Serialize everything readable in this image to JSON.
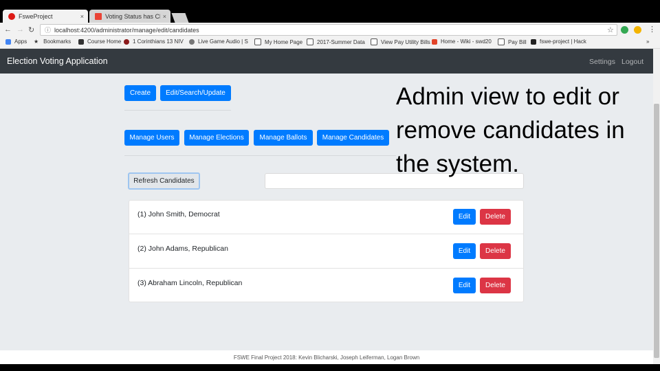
{
  "browser": {
    "tabs": [
      {
        "title": "FsweProject",
        "close": "×",
        "favicon_color": "#dd1b16"
      },
      {
        "title": "Voting Status has Change",
        "close": "×",
        "favicon_color": "#ea4335"
      }
    ],
    "url": "localhost:4200/administrator/manage/edit/candidates",
    "bookmarks": [
      {
        "label": "Apps"
      },
      {
        "label": "Bookmarks"
      },
      {
        "label": "Course Home"
      },
      {
        "label": "1 Corinthians 13 NIV"
      },
      {
        "label": "Live Game Audio | S"
      },
      {
        "label": "My Home Page"
      },
      {
        "label": "2017-Summer Data"
      },
      {
        "label": "View Pay Utility Bills"
      },
      {
        "label": "Home - Wiki - swd20"
      },
      {
        "label": "Pay Bill"
      },
      {
        "label": "fswe-project | Hack"
      },
      {
        "label": "»"
      }
    ]
  },
  "app": {
    "brand": "Election Voting Application",
    "nav": {
      "settings": "Settings",
      "logout": "Logout"
    },
    "toolbar": {
      "create": "Create",
      "edit_search_update": "Edit/Search/Update"
    },
    "manage": {
      "users": "Manage Users",
      "elections": "Manage Elections",
      "ballots": "Manage Ballots",
      "candidates": "Manage Candidates"
    },
    "refresh_label": "Refresh Candidates",
    "search_value": "",
    "candidates": [
      {
        "label": "(1) John Smith, Democrat",
        "edit": "Edit",
        "delete": "Delete"
      },
      {
        "label": "(2) John Adams, Republican",
        "edit": "Edit",
        "delete": "Delete"
      },
      {
        "label": "(3) Abraham Lincoln, Republican",
        "edit": "Edit",
        "delete": "Delete"
      }
    ],
    "footer": "FSWE Final Project 2018: Kevin Blicharski, Joseph Leiferman, Logan Brown"
  },
  "annotation": "Admin view to edit or remove candidates in the system.",
  "colors": {
    "primary": "#007bff",
    "danger": "#dc3545",
    "navbar": "#343a40",
    "page_bg": "#e9ecef"
  }
}
